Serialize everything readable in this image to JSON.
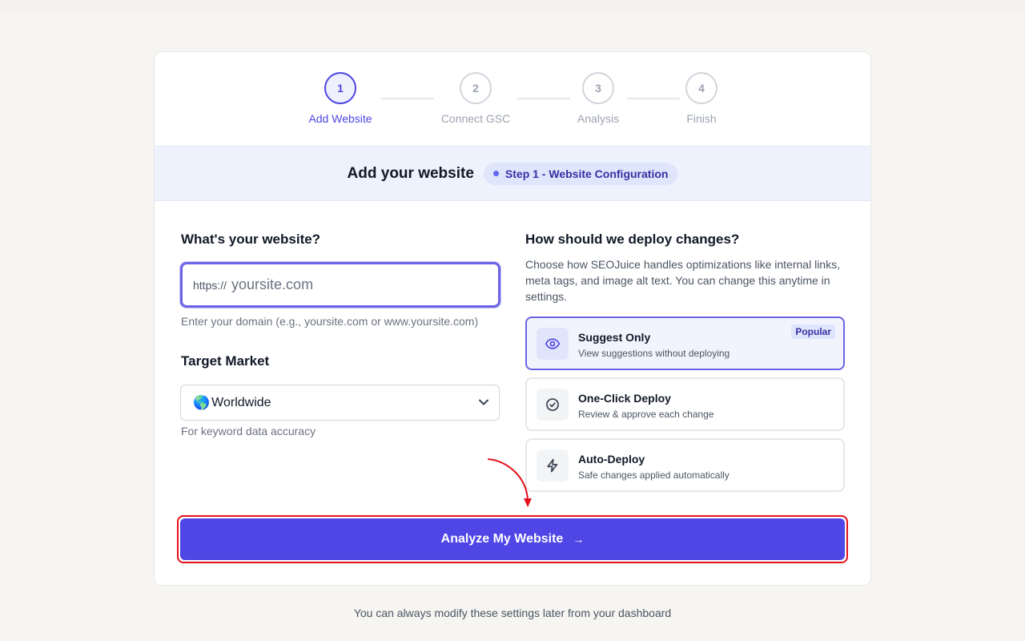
{
  "stepper": {
    "steps": [
      {
        "number": "1",
        "label": "Add Website"
      },
      {
        "number": "2",
        "label": "Connect GSC"
      },
      {
        "number": "3",
        "label": "Analysis"
      },
      {
        "number": "4",
        "label": "Finish"
      }
    ],
    "active_step": 1
  },
  "banner": {
    "title": "Add your website",
    "badge": "Step 1 - Website Configuration"
  },
  "website": {
    "heading": "What's your website?",
    "prefix": "https://",
    "value": "",
    "placeholder": "yoursite.com",
    "hint": "Enter your domain (e.g., yoursite.com or www.yoursite.com)"
  },
  "market": {
    "heading": "Target Market",
    "selected_icon": "🌎",
    "selected": "Worldwide",
    "hint": "For keyword data accuracy"
  },
  "deploy": {
    "heading": "How should we deploy changes?",
    "description": "Choose how SEOJuice handles optimizations like internal links, meta tags, and image alt text. You can change this anytime in settings.",
    "options": [
      {
        "title": "Suggest Only",
        "subtitle": "View suggestions without deploying",
        "icon": "eye-icon",
        "badge": "Popular"
      },
      {
        "title": "One-Click Deploy",
        "subtitle": "Review & approve each change",
        "icon": "check-circle-icon"
      },
      {
        "title": "Auto-Deploy",
        "subtitle": "Safe changes applied automatically",
        "icon": "lightning-icon"
      }
    ],
    "selected_index": 0
  },
  "cta": {
    "label": "Analyze My Website",
    "arrow": "→"
  },
  "footer": "You can always modify these settings later from your dashboard",
  "colors": {
    "accent": "#4f46e5",
    "highlight": "#e3111b",
    "banner_bg": "#edf2fd",
    "page_bg": "#f6f5f2"
  }
}
